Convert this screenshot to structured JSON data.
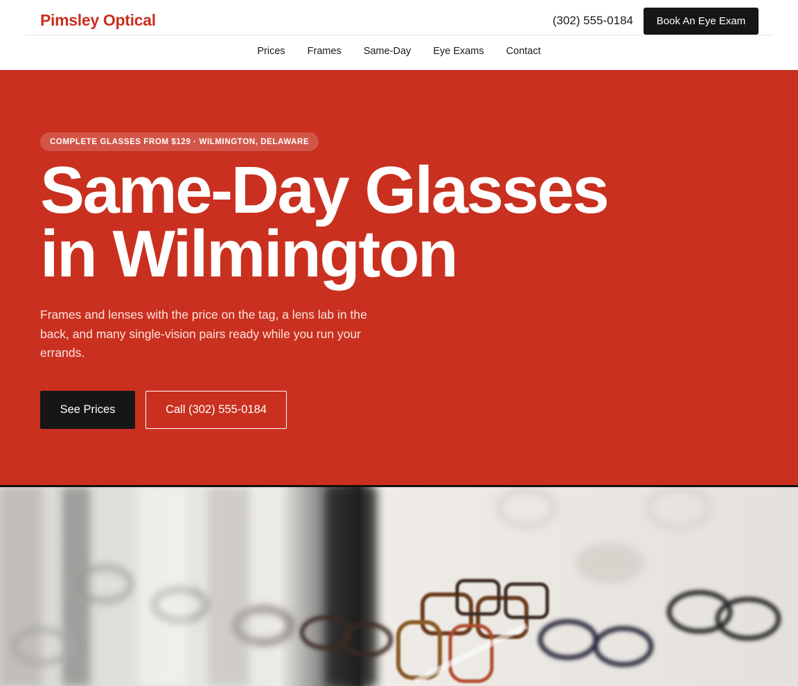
{
  "header": {
    "brand": "Pimsley Optical",
    "phone": "(302) 555-0184",
    "book_label": "Book An Eye Exam"
  },
  "nav": {
    "items": [
      {
        "label": "Prices"
      },
      {
        "label": "Frames"
      },
      {
        "label": "Same-Day"
      },
      {
        "label": "Eye Exams"
      },
      {
        "label": "Contact"
      }
    ]
  },
  "hero": {
    "badge": "COMPLETE GLASSES FROM $129 · WILMINGTON, DELAWARE",
    "headline_line1": "Same-Day Glasses",
    "headline_line2": "in Wilmington",
    "subtext": "Frames and lenses with the price on the tag, a lens lab in the back, and many single-vision pairs ready while you run your errands.",
    "primary_cta": "See Prices",
    "secondary_cta": "Call (302) 555-0184"
  },
  "colors": {
    "brand_red": "#c9301f",
    "dark": "#161616",
    "white": "#ffffff"
  },
  "image": {
    "description_icon": "eyeglasses-display-photo"
  }
}
